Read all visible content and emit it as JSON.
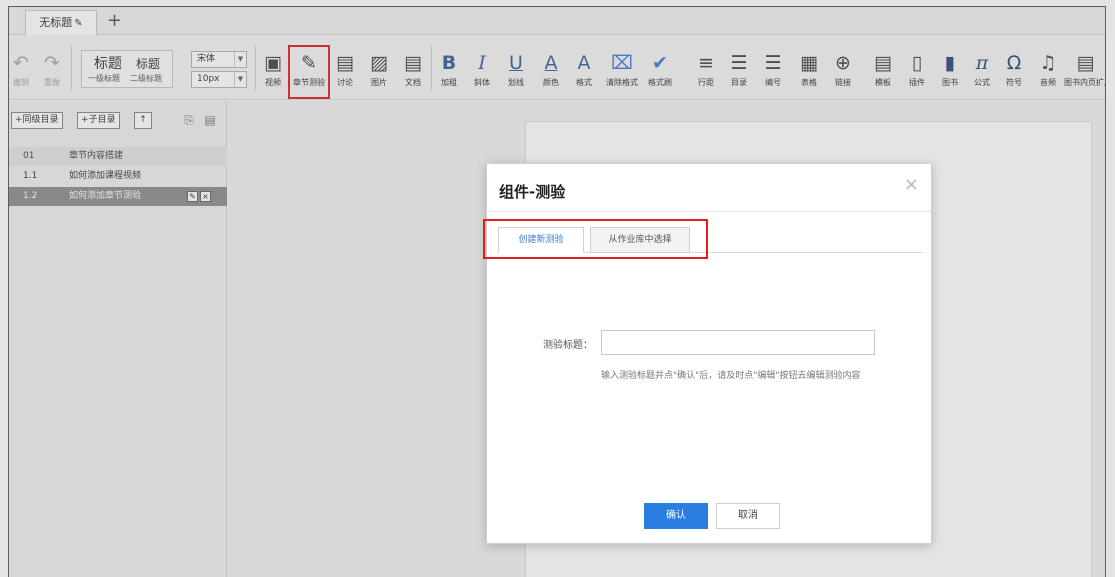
{
  "tabs": {
    "doc_title": "无标题",
    "add_symbol": "+"
  },
  "toolbar": {
    "undo": "撤销",
    "redo": "重做",
    "heading_main": "标题",
    "heading_sub": "标题",
    "heading_level1": "一级标题",
    "heading_level2": "二级标题",
    "font_family": "宋体",
    "font_size": "10px",
    "video": "视频",
    "quiz": "章节测验",
    "discuss": "讨论",
    "image": "图片",
    "document": "文档",
    "bold": "加粗",
    "italic": "斜体",
    "underline": "划线",
    "color": "颜色",
    "format": "格式",
    "clear_format": "清除格式",
    "format_painter": "格式刷",
    "line_height": "行距",
    "toc": "目录",
    "numbering": "编号",
    "table": "表格",
    "link": "链接",
    "template": "模板",
    "plugin": "插件",
    "book": "图书",
    "formula": "公式",
    "symbol": "符号",
    "audio": "音频",
    "book_extend": "图书内页扩展",
    "glyph_bold": "B",
    "glyph_italic": "I",
    "glyph_underline": "U",
    "glyph_color": "A",
    "glyph_format": "A",
    "glyph_pi": "π",
    "glyph_omega": "Ω"
  },
  "sidebar": {
    "btn_same_level": "+同级目录",
    "btn_child": "+子目录",
    "btn_up": "↑",
    "chapters": [
      {
        "num": "01",
        "title": "章节内容搭建"
      },
      {
        "num": "1.1",
        "title": "如何添加课程视频"
      },
      {
        "num": "1.2",
        "title": "如何添加章节测验"
      }
    ]
  },
  "modal": {
    "title": "组件-测验",
    "close": "×",
    "tab_create": "创建新测验",
    "tab_from_bank": "从作业库中选择",
    "field_label": "测验标题：",
    "field_value": "",
    "hint": "输入测验标题并点\"确认\"后，请及时点\"编辑\"按钮去编辑测验内容",
    "confirm": "确认",
    "cancel": "取消"
  },
  "colors": {
    "accent": "#2a7de1",
    "highlight": "#e02020",
    "active_row": "#8e8e8e"
  }
}
